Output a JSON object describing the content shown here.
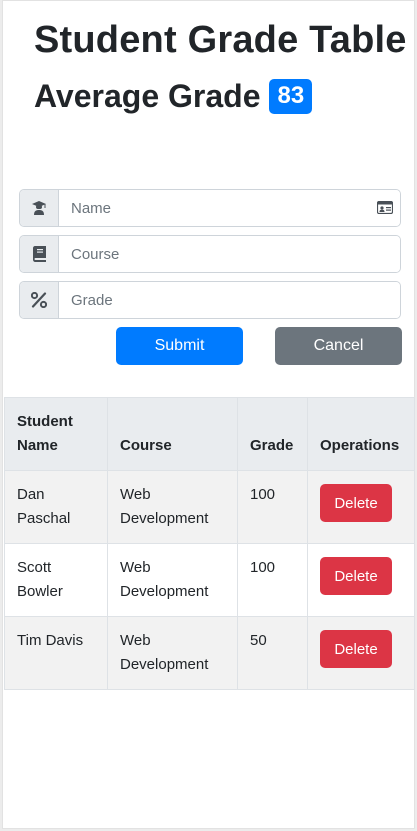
{
  "header": {
    "title": "Student Grade Table",
    "average_label": "Average Grade",
    "average_value": "83"
  },
  "form": {
    "name_placeholder": "Name",
    "course_placeholder": "Course",
    "grade_placeholder": "Grade",
    "name_icon": "graduate-icon",
    "course_icon": "book-icon",
    "grade_icon": "percent-icon",
    "name_card_icon": "id-card-icon",
    "submit_label": "Submit",
    "cancel_label": "Cancel"
  },
  "table": {
    "headers": [
      "Student Name",
      "Course",
      "Grade",
      "Operations"
    ],
    "rows": [
      {
        "name": "Dan Paschal",
        "course": "Web Development",
        "grade": "100",
        "action": "Delete"
      },
      {
        "name": "Scott Bowler",
        "course": "Web Development",
        "grade": "100",
        "action": "Delete"
      },
      {
        "name": "Tim Davis",
        "course": "Web Development",
        "grade": "50",
        "action": "Delete"
      }
    ]
  },
  "colors": {
    "primary": "#007bff",
    "secondary": "#6c757d",
    "danger": "#dc3545"
  }
}
